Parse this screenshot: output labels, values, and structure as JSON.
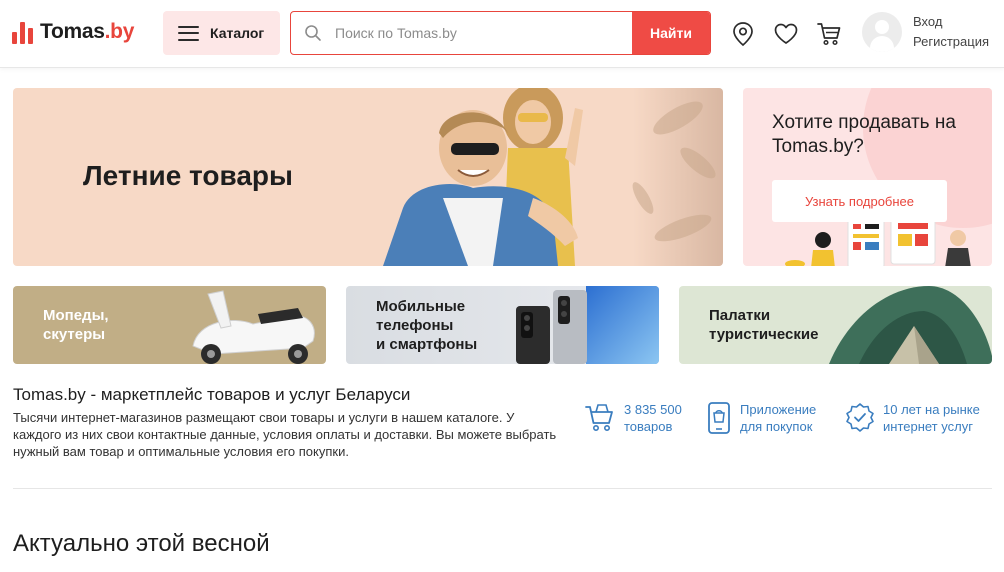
{
  "header": {
    "logo_text": "Tomas",
    "logo_suffix": ".by",
    "catalog_label": "Каталог",
    "search_placeholder": "Поиск по Tomas.by",
    "search_button": "Найти",
    "login_label": "Вход",
    "register_label": "Регистрация"
  },
  "hero": {
    "title": "Летние товары"
  },
  "sell_banner": {
    "title": "Хотите продавать на Tomas.by?",
    "button": "Узнать подробнее"
  },
  "categories": [
    {
      "label": "Мопеды,\nскутеры"
    },
    {
      "label": "Мобильные\nтелефоны\nи смартфоны"
    },
    {
      "label": "Палатки\nтуристические"
    }
  ],
  "about": {
    "title": "Tomas.by - маркетплейс товаров и услуг Беларуси",
    "text": "Тысячи интернет-магазинов размещают свои товары и услуги в нашем каталоге. У каждого из них свои контактные данные, условия оплаты и доставки. Вы можете выбрать нужный вам товар и оптимальные условия его покупки."
  },
  "stats": [
    {
      "text": "3 835 500\nтоваров",
      "icon": "cart-icon"
    },
    {
      "text": "Приложение\nдля покупок",
      "icon": "phone-icon"
    },
    {
      "text": "10 лет на рынке\nинтернет услуг",
      "icon": "badge-icon"
    }
  ],
  "section": {
    "title": "Актуально этой весной"
  },
  "colors": {
    "accent": "#ef4b45",
    "link": "#3a7dbf",
    "catalog_bg": "#fde7e7"
  }
}
